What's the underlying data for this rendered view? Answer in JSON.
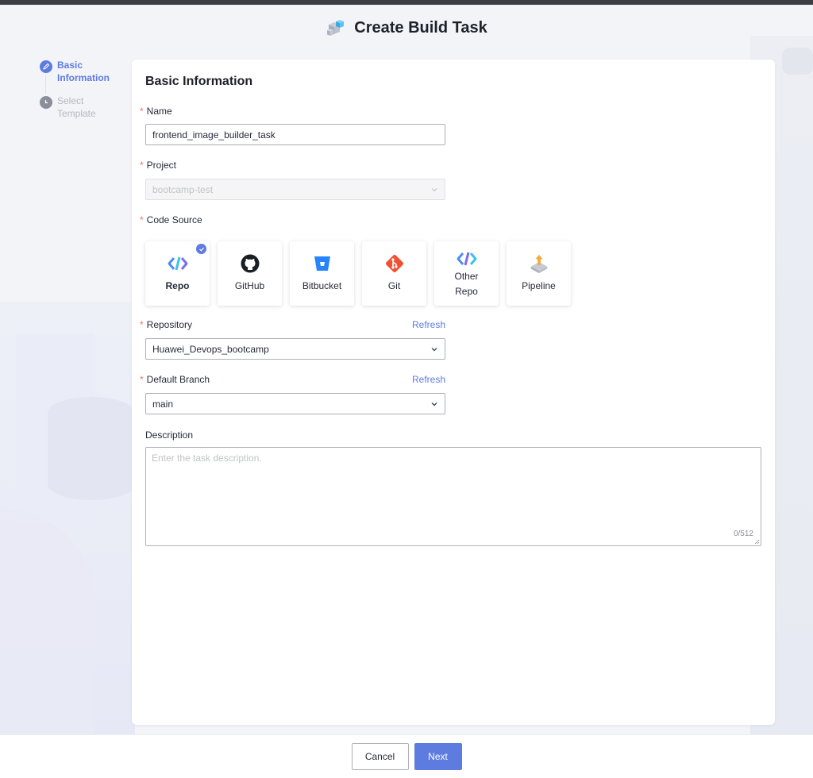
{
  "page": {
    "title": "Create Build Task"
  },
  "colors": {
    "accent": "#5e7ce0",
    "required": "#f66f6a",
    "pending_step": "#8a8e99"
  },
  "steps": [
    {
      "label": "Basic Information",
      "state": "active",
      "icon": "edit-icon"
    },
    {
      "label": "Select Template",
      "state": "pending",
      "icon": "clock-icon"
    }
  ],
  "form": {
    "section_title": "Basic Information",
    "required_mark": "*",
    "name": {
      "label": "Name",
      "value": "frontend_image_builder_task"
    },
    "project": {
      "label": "Project",
      "value": "bootcamp-test"
    },
    "code_source": {
      "label": "Code Source",
      "selected": "Repo",
      "options": [
        {
          "label": "Repo",
          "icon": "repo-icon"
        },
        {
          "label": "GitHub",
          "icon": "github-icon"
        },
        {
          "label": "Bitbucket",
          "icon": "bitbucket-icon"
        },
        {
          "label": "Git",
          "icon": "git-icon"
        },
        {
          "label": "Other Repo",
          "label_line1": "Other",
          "label_line2": "Repo",
          "icon": "other-repo-icon"
        },
        {
          "label": "Pipeline",
          "icon": "pipeline-icon"
        }
      ]
    },
    "repository": {
      "label": "Repository",
      "refresh": "Refresh",
      "value": "Huawei_Devops_bootcamp"
    },
    "branch": {
      "label": "Default Branch",
      "refresh": "Refresh",
      "value": "main"
    },
    "description": {
      "label": "Description",
      "placeholder": "Enter the task description.",
      "counter": "0/512"
    }
  },
  "footer": {
    "cancel": "Cancel",
    "next": "Next"
  }
}
